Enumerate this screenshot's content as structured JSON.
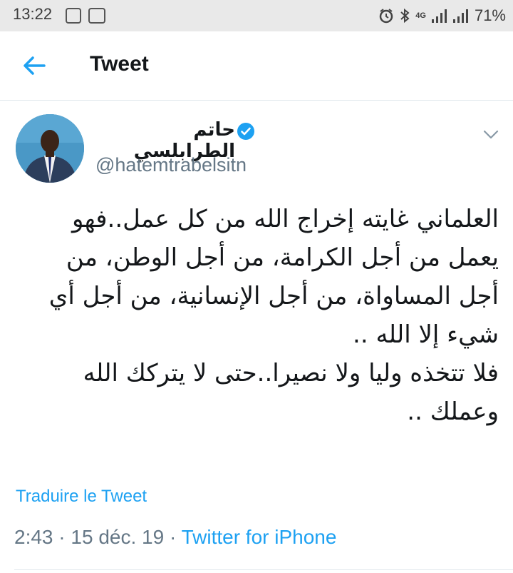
{
  "status_bar": {
    "time": "13:22",
    "network": "4G",
    "battery": "71%",
    "icons": [
      "media-notification-icon",
      "app-notification-icon",
      "alarm-icon",
      "bluetooth-icon",
      "signal-icon",
      "signal-icon",
      "battery-icon"
    ]
  },
  "header": {
    "title": "Tweet",
    "back_icon": "arrow-left-icon"
  },
  "tweet": {
    "author_name": "حاتم الطرابلسي",
    "handle": "@hatemtrabelsitn",
    "verified": true,
    "text_lines": [
      "العلماني غايته إخراج الله من كل عمل..فهو",
      "يعمل من أجل الكرامة، من أجل الوطن، من",
      "أجل المساواة، من أجل الإنسانية، من أجل أي",
      "شيء إلا الله ..",
      "فلا تتخذه وليا ولا نصيرا..حتى لا يتركك الله",
      "وعملك .."
    ],
    "translate_label": "Traduire le Tweet",
    "time": "2:43",
    "separator": "·",
    "date": "15 déc. 19",
    "source": "Twitter for iPhone"
  },
  "colors": {
    "accent": "#1da1f2",
    "secondary_text": "#657786",
    "status_bar_bg": "#e9e9e9",
    "divider": "#e1e8ed"
  }
}
